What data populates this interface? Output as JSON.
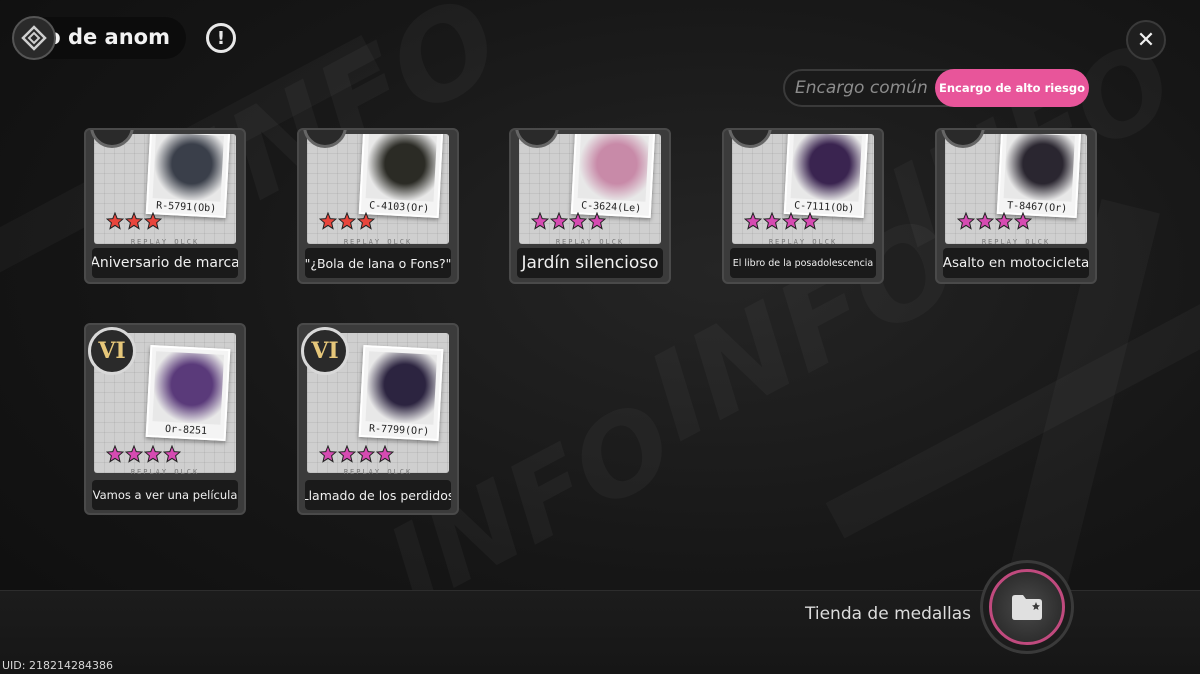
{
  "header": {
    "title": "o de anom",
    "info_icon": "exclamation-circle-icon",
    "close_icon": "close-icon"
  },
  "tabs": {
    "common_label": "Encargo común",
    "high_risk_label": "Encargo de alto riesgo",
    "active": "high_risk",
    "active_color": "#e8559a"
  },
  "cards": [
    {
      "title": "Aniversario de marca",
      "code": "R-5791(Ob)",
      "stars": 3,
      "star_color": "#e8453c",
      "art_color": "#3a3f4a"
    },
    {
      "title": "\"¿Bola de lana o Fons?\"",
      "code": "C-4103(Or)",
      "stars": 3,
      "star_color": "#e8453c",
      "art_color": "#2b2b25"
    },
    {
      "title": "Jardín silencioso",
      "code": "C-3624(Le)",
      "stars": 4,
      "star_color": "#d64bb2",
      "art_color": "#c88aa8"
    },
    {
      "title": "El libro de la posadolescencia",
      "code": "C-7111(Ob)",
      "stars": 4,
      "star_color": "#d64bb2",
      "art_color": "#3a2450"
    },
    {
      "title": "Asalto en motocicleta",
      "code": "T-8467(Or)",
      "stars": 4,
      "star_color": "#d64bb2",
      "art_color": "#2a2630"
    },
    {
      "title": "¡Vamos a ver una película!",
      "code": "Or-8251",
      "stars": 4,
      "star_color": "#d64bb2",
      "art_color": "#5a3a7a",
      "rank": "VI"
    },
    {
      "title": "Llamado de los perdidos",
      "code": "R-7799(Or)",
      "stars": 4,
      "star_color": "#d64bb2",
      "art_color": "#2c2440",
      "rank": "VI"
    }
  ],
  "replay_text": "REPLAY OLCK",
  "shop": {
    "label": "Tienda de medallas",
    "icon": "folder-star-icon"
  },
  "uid_text": "UID: 218214284386"
}
